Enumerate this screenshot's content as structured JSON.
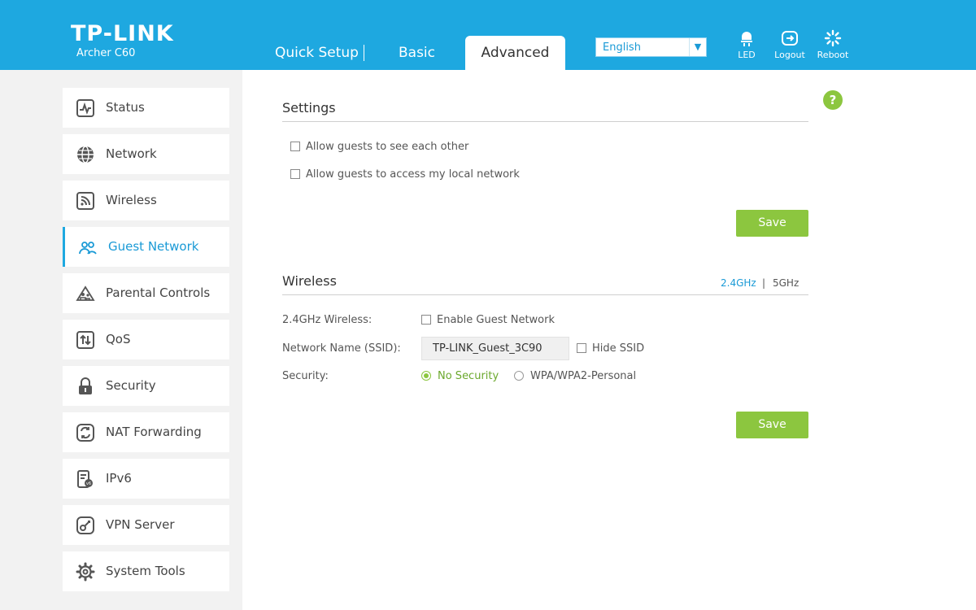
{
  "header": {
    "logo": "TP-LINK",
    "model": "Archer C60",
    "tabs": [
      {
        "label": "Quick Setup"
      },
      {
        "label": "Basic"
      },
      {
        "label": "Advanced"
      }
    ],
    "language": "English",
    "buttons": {
      "led": "LED",
      "logout": "Logout",
      "reboot": "Reboot"
    }
  },
  "sidebar": {
    "items": [
      {
        "label": "Status",
        "icon": "status-icon"
      },
      {
        "label": "Network",
        "icon": "globe-icon"
      },
      {
        "label": "Wireless",
        "icon": "wireless-icon"
      },
      {
        "label": "Guest Network",
        "icon": "guest-network-icon",
        "active": true
      },
      {
        "label": "Parental Controls",
        "icon": "parental-controls-icon"
      },
      {
        "label": "QoS",
        "icon": "qos-icon"
      },
      {
        "label": "Security",
        "icon": "lock-icon"
      },
      {
        "label": "NAT Forwarding",
        "icon": "nat-forwarding-icon"
      },
      {
        "label": "IPv6",
        "icon": "ipv6-icon"
      },
      {
        "label": "VPN Server",
        "icon": "vpn-icon"
      },
      {
        "label": "System Tools",
        "icon": "gear-icon"
      }
    ]
  },
  "settings": {
    "title": "Settings",
    "options": [
      {
        "label": "Allow guests to see each other",
        "checked": false
      },
      {
        "label": "Allow guests to access my local network",
        "checked": false
      }
    ],
    "save_label": "Save"
  },
  "wireless": {
    "title": "Wireless",
    "band_24": "2.4GHz",
    "band_sep": "|",
    "band_5": "5GHz",
    "wireless_label": "2.4GHz Wireless:",
    "enable_label": "Enable Guest Network",
    "ssid_label": "Network Name (SSID):",
    "ssid_value": "TP-LINK_Guest_3C90",
    "hide_ssid_label": "Hide SSID",
    "security_label": "Security:",
    "security_options": [
      {
        "label": "No Security",
        "selected": true
      },
      {
        "label": "WPA/WPA2-Personal",
        "selected": false
      }
    ],
    "save_label": "Save"
  },
  "help_symbol": "?",
  "colors": {
    "header": "#1ea8e0",
    "accent": "#1a9ad6",
    "save_button": "#8cc63f"
  }
}
